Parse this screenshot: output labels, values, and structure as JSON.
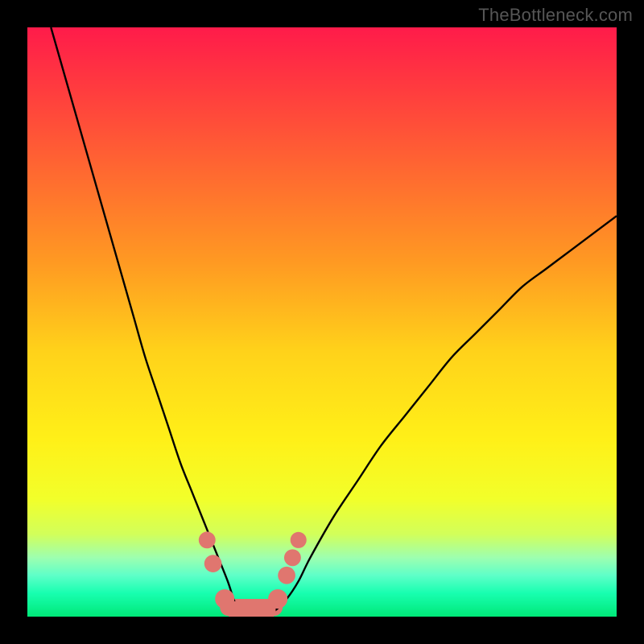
{
  "watermark": "TheBottleneck.com",
  "colors": {
    "frame": "#000000",
    "curve": "#000000",
    "marker_fill": "#e0766f",
    "marker_stroke": "#d55f58"
  },
  "gradient_stops": [
    {
      "offset": 0.0,
      "color": "#ff1b4a"
    },
    {
      "offset": 0.1,
      "color": "#ff3a3f"
    },
    {
      "offset": 0.25,
      "color": "#ff6a30"
    },
    {
      "offset": 0.4,
      "color": "#ff9a22"
    },
    {
      "offset": 0.55,
      "color": "#ffd21a"
    },
    {
      "offset": 0.7,
      "color": "#fff018"
    },
    {
      "offset": 0.8,
      "color": "#f2ff2a"
    },
    {
      "offset": 0.86,
      "color": "#d2ff5a"
    },
    {
      "offset": 0.9,
      "color": "#9dffb0"
    },
    {
      "offset": 0.93,
      "color": "#5effc8"
    },
    {
      "offset": 0.96,
      "color": "#18ffb0"
    },
    {
      "offset": 1.0,
      "color": "#00e878"
    }
  ],
  "chart_data": {
    "type": "line",
    "title": "",
    "xlabel": "",
    "ylabel": "",
    "xlim": [
      0,
      100
    ],
    "ylim": [
      0,
      100
    ],
    "series": [
      {
        "name": "bottleneck-curve",
        "x": [
          4,
          6,
          8,
          10,
          12,
          14,
          16,
          18,
          20,
          22,
          24,
          26,
          28,
          30,
          32,
          34,
          35,
          36,
          38,
          40,
          42,
          44,
          46,
          48,
          52,
          56,
          60,
          64,
          68,
          72,
          76,
          80,
          84,
          88,
          92,
          96,
          100
        ],
        "y": [
          100,
          93,
          86,
          79,
          72,
          65,
          58,
          51,
          44,
          38,
          32,
          26,
          21,
          16,
          11,
          6,
          3,
          1,
          0,
          0,
          1,
          3,
          6,
          10,
          17,
          23,
          29,
          34,
          39,
          44,
          48,
          52,
          56,
          59,
          62,
          65,
          68
        ]
      }
    ],
    "markers": [
      {
        "x": 30.5,
        "y": 13,
        "r": 1.6
      },
      {
        "x": 31.5,
        "y": 9,
        "r": 1.7
      },
      {
        "x": 33.5,
        "y": 3,
        "r": 2.0
      },
      {
        "x": 35.5,
        "y": 1,
        "r": 2.0
      },
      {
        "x": 38.0,
        "y": 0,
        "r": 2.0
      },
      {
        "x": 40.5,
        "y": 1,
        "r": 2.0
      },
      {
        "x": 42.5,
        "y": 3,
        "r": 2.0
      },
      {
        "x": 44.0,
        "y": 7,
        "r": 1.7
      },
      {
        "x": 45.0,
        "y": 10,
        "r": 1.6
      },
      {
        "x": 46.0,
        "y": 13,
        "r": 1.5
      }
    ],
    "bottom_band_y": 1.5
  }
}
